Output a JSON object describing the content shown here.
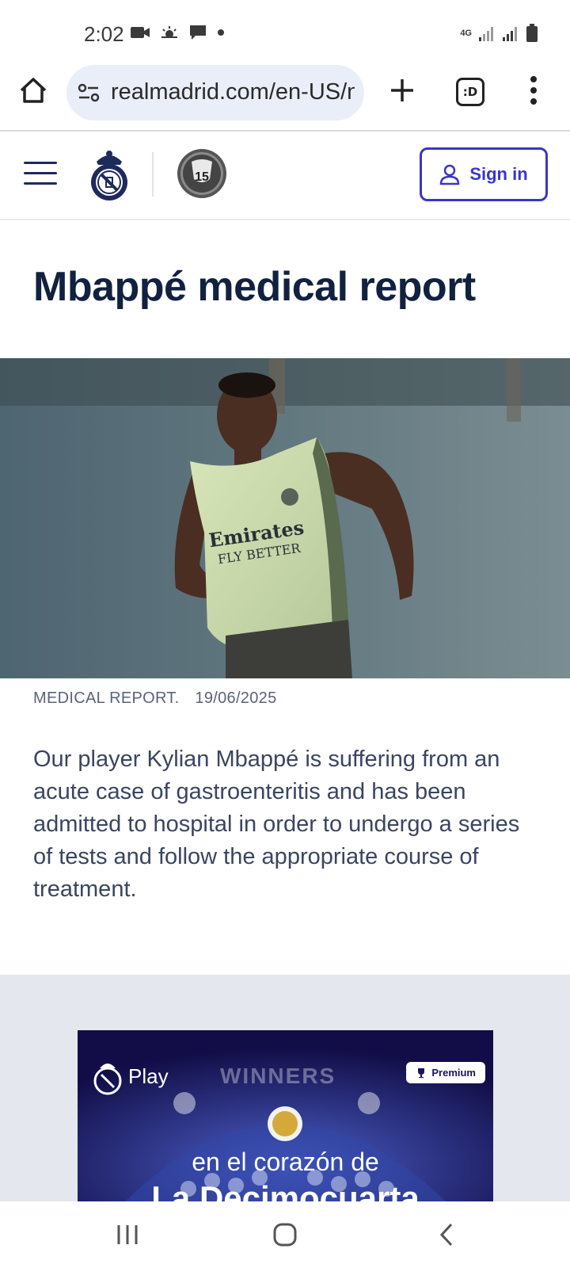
{
  "status_bar": {
    "time": "2:02",
    "left_icons": [
      "video-icon",
      "weather-icon",
      "message-icon",
      "dot-icon"
    ],
    "network_label": "4G",
    "right_icons": [
      "signal-icon",
      "signal-icon",
      "battery-icon"
    ]
  },
  "browser": {
    "url": "realmadrid.com/en-US/n",
    "tabs_label": ":D"
  },
  "header": {
    "signin_label": "Sign in",
    "badge_number": "15"
  },
  "article": {
    "title": "Mbappé medical report",
    "category": "MEDICAL REPORT.",
    "date": "19/06/2025",
    "body": "Our player Kylian Mbappé is suffering from an acute case of gastroenteritis and has been admitted to hospital in order to undergo a series of tests and follow the appropriate course of treatment.",
    "jersey_text_1": "Emirates",
    "jersey_text_2": "FLY BETTER"
  },
  "promo": {
    "play_label": "Play",
    "premium_label": "Premium",
    "winners_text": "WINNERS",
    "line1": "en el corazón de",
    "line2": "La Decimocuarta"
  },
  "colors": {
    "brand_blue": "#3b35c8",
    "title_navy": "#12213f",
    "promo_bg": "#e4e7ed"
  }
}
